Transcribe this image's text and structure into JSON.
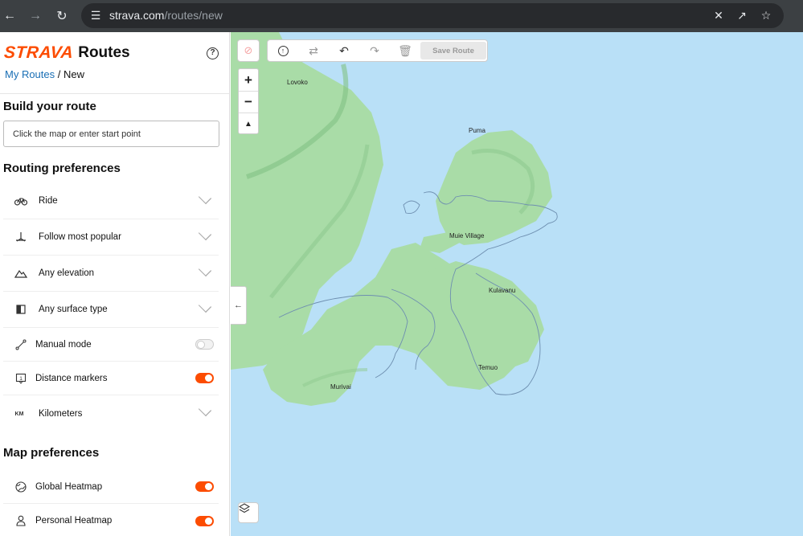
{
  "browser": {
    "url_host": "strava.com",
    "url_path": "/routes/new"
  },
  "header": {
    "logo_text": "STRAVA",
    "app_title": "Routes",
    "help_label": "?"
  },
  "breadcrumb": {
    "parent": "My Routes",
    "separator": " / ",
    "current": "New"
  },
  "build": {
    "heading": "Build your route",
    "start_placeholder": "Click the map or enter start point"
  },
  "routing": {
    "heading": "Routing preferences",
    "items": [
      {
        "label": "Ride",
        "icon": "bike-icon",
        "control": "dropdown"
      },
      {
        "label": "Follow most popular",
        "icon": "popularity-icon",
        "control": "dropdown"
      },
      {
        "label": "Any elevation",
        "icon": "elevation-icon",
        "control": "dropdown"
      },
      {
        "label": "Any surface type",
        "icon": "surface-icon",
        "control": "dropdown"
      },
      {
        "label": "Manual mode",
        "icon": "manual-mode-icon",
        "control": "toggle",
        "on": false
      },
      {
        "label": "Distance markers",
        "icon": "distance-marker-icon",
        "control": "toggle",
        "on": true
      },
      {
        "label": "Kilometers",
        "icon": "km-icon",
        "icon_text": "KM",
        "control": "dropdown"
      }
    ]
  },
  "map_prefs": {
    "heading": "Map preferences",
    "items": [
      {
        "label": "Global Heatmap",
        "icon": "globe-icon",
        "control": "toggle",
        "on": true
      },
      {
        "label": "Personal Heatmap",
        "icon": "person-icon",
        "control": "toggle",
        "on": true
      }
    ]
  },
  "map": {
    "toolbar": {
      "save_label": "Save Route"
    },
    "labels": [
      "Lovoko",
      "Puma",
      "Muie Village",
      "Kulavanu",
      "Temuo",
      "Murivai"
    ],
    "colors": {
      "water": "#b9e0f7",
      "land": "#a9dca7",
      "accent": "#fc4c02"
    }
  }
}
